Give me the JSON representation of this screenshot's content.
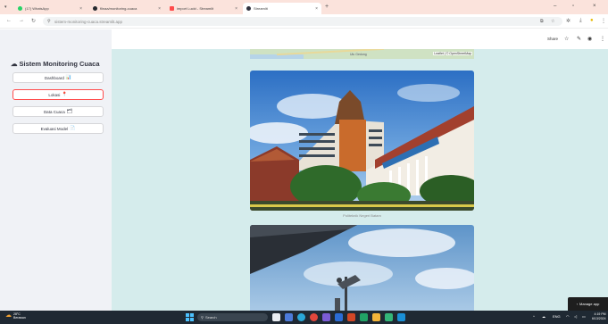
{
  "browser": {
    "tabs": [
      {
        "title": "(17) WhatsApp",
        "icon_color": "#25d366",
        "active": false
      },
      {
        "title": "flinaa/monitoring-cuaca",
        "icon_color": "#24292f",
        "active": false
      },
      {
        "title": "import Luckt - Streamlit",
        "icon_color": "#ff4b4b",
        "active": false
      },
      {
        "title": "Streamlit",
        "icon_color": "#31333f",
        "active": true
      }
    ],
    "new_tab": "+",
    "url": "sistem-monitoring-cuaca.streamlit.app"
  },
  "app": {
    "header": {
      "share_label": "Share"
    },
    "sidebar": {
      "title": "Sistem Monitoring Cuaca",
      "title_icon": "cloud-icon",
      "items": [
        {
          "label": "Dashboard",
          "icon": "📊",
          "active": false
        },
        {
          "label": "Lokasi",
          "icon": "📍",
          "active": true
        },
        {
          "label": "Data Cuaca",
          "icon": "🗂",
          "active": false
        },
        {
          "label": "Evaluasi Model",
          "icon": "📄",
          "active": false
        }
      ]
    },
    "main": {
      "map_attribution": "Leaflet | © OpenStreetMap",
      "map_label": "Ulu Gedong",
      "photo1_caption": "Politeknik Negeri Batam",
      "manage_label": "Manage app",
      "accent": "#ff4b4b"
    }
  },
  "taskbar": {
    "weather_temp": "28°C",
    "weather_desc": "Berawan",
    "search_placeholder": "Search",
    "lang": "ENG",
    "time": "4:19 PM",
    "date": "6/13/2024"
  }
}
